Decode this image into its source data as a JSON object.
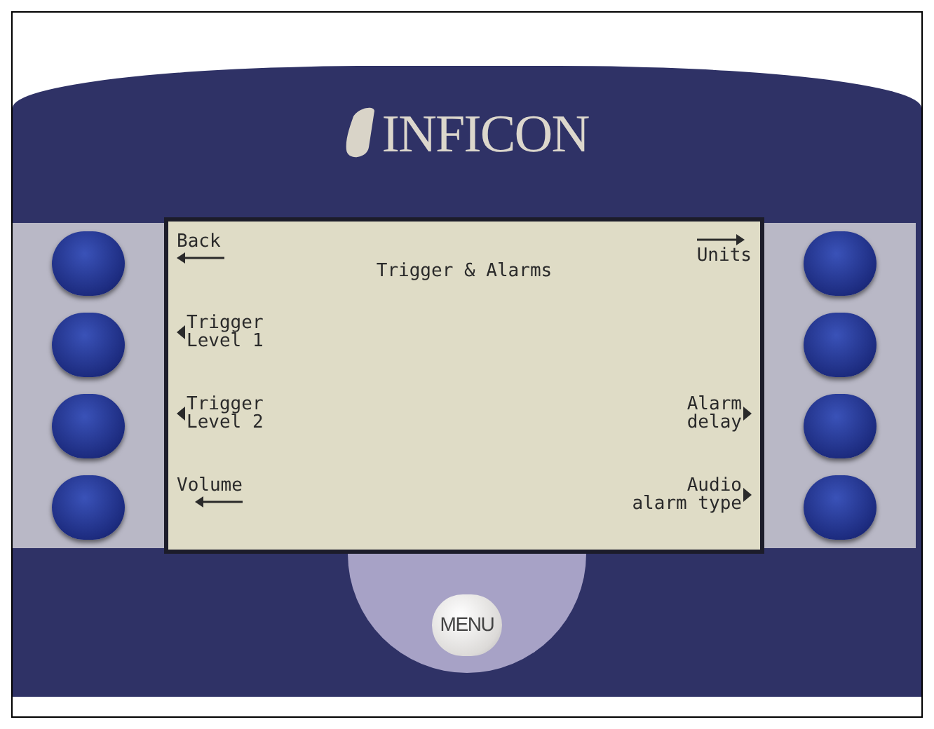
{
  "device": {
    "logo": "INFICON",
    "menu_button": "MENU"
  },
  "screen": {
    "title": "Trigger & Alarms",
    "left_keys": [
      {
        "lines": [
          "Back"
        ],
        "kind": "line"
      },
      {
        "lines": [
          "Trigger",
          "Level 1"
        ],
        "kind": "pointer"
      },
      {
        "lines": [
          "Trigger",
          "Level 2"
        ],
        "kind": "pointer"
      },
      {
        "lines": [
          "Volume"
        ],
        "kind": "line"
      }
    ],
    "right_keys": [
      {
        "lines": [
          "Units"
        ],
        "kind": "line"
      },
      {
        "kind": "none"
      },
      {
        "lines": [
          "Alarm",
          "delay"
        ],
        "kind": "pointer"
      },
      {
        "lines": [
          "Audio",
          "alarm type"
        ],
        "kind": "pointer"
      }
    ]
  }
}
